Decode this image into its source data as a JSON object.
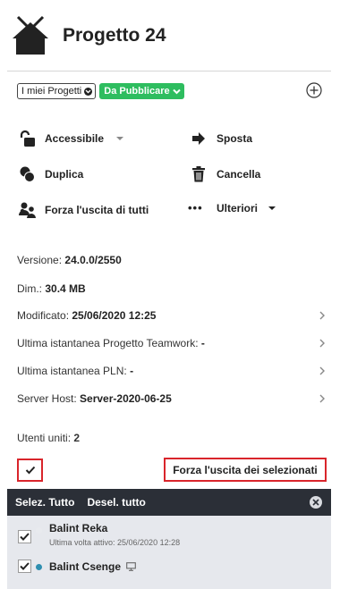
{
  "project": {
    "title": "Progetto 24",
    "icon": "teamwork-house-icon"
  },
  "filters": {
    "mine_label": "I miei Progetti",
    "status_label": "Da Pubblicare",
    "status_color": "#2ebd5f"
  },
  "actions": {
    "accessible": "Accessibile",
    "move": "Sposta",
    "duplicate": "Duplica",
    "delete": "Cancella",
    "force_logout_all": "Forza l'uscita di tutti",
    "more": "Ulteriori",
    "more_glyph": "•••"
  },
  "info": {
    "version_label": "Versione:",
    "version_value": "24.0.0/2550",
    "size_label": "Dim.:",
    "size_value": "30.4 MB",
    "modified_label": "Modificato:",
    "modified_value": "25/06/2020 12:25",
    "teamwork_snapshot_label": "Ultima istantanea Progetto Teamwork:",
    "teamwork_snapshot_value": "-",
    "pln_snapshot_label": "Ultima istantanea PLN:",
    "pln_snapshot_value": "-",
    "server_label": "Server Host:",
    "server_value": "Server-2020-06-25"
  },
  "users": {
    "joined_label": "Utenti uniti:",
    "joined_count": "2",
    "force_selected_label": "Forza l'uscita dei selezionati",
    "select_all": "Selez. Tutto",
    "deselect_all": "Desel. tutto",
    "list": [
      {
        "name": "Balint Reka",
        "last_active": "Ultima volta attivo: 25/06/2020 12:28",
        "checked": true,
        "status_color": "#e8eaee"
      },
      {
        "name": "Balint Csenge",
        "checked": true,
        "status_color": "#2f8fb0"
      }
    ]
  },
  "colors": {
    "highlight_border": "#d9252b",
    "bar_bg": "#2b2f37",
    "list_bg": "#e6e8ed"
  }
}
